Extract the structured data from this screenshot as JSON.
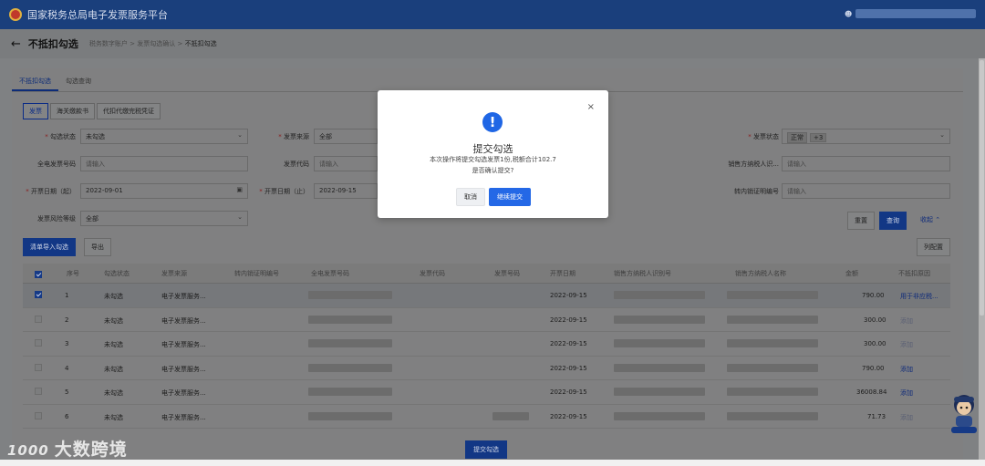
{
  "app": {
    "title": "国家税务总局电子发票服务平台",
    "user_icon": "user-icon"
  },
  "header": {
    "back_icon": "←",
    "title": "不抵扣勾选",
    "crumb1": "税务数字账户",
    "crumb2": "发票勾选确认",
    "crumb3": "不抵扣勾选",
    "sep": ">"
  },
  "tabs": [
    "不抵扣勾选",
    "勾选查询"
  ],
  "subtabs": [
    "发票",
    "海关缴款书",
    "代扣代缴完税凭证"
  ],
  "filters": {
    "check_status_label": "勾选状态",
    "check_status_value": "未勾选",
    "source_label": "发票来源",
    "source_value": "全部",
    "invoice_status_label": "发票状态",
    "invoice_status_tag": "正常",
    "invoice_status_more": "+3",
    "einvoice_no_label": "全电发票号码",
    "einvoice_no_placeholder": "请输入",
    "invoice_code_label": "发票代码",
    "invoice_code_placeholder": "请输入",
    "seller_id_label": "销售方纳税人识...",
    "seller_id_placeholder": "请输入",
    "date_start_label": "开票日期（起）",
    "date_start_value": "2022-09-01",
    "date_end_label": "开票日期（止）",
    "date_end_value": "2022-09-15",
    "transfer_no_label": "转内销证明编号",
    "transfer_no_placeholder": "请输入",
    "risk_label": "发票风险等级",
    "risk_value": "全部"
  },
  "buttons": {
    "reset": "重置",
    "query": "查询",
    "collapse": "收起",
    "import": "清单导入勾选",
    "export": "导出",
    "columns": "列配置",
    "submit": "提交勾选"
  },
  "table": {
    "headers": [
      "序号",
      "勾选状态",
      "发票来源",
      "转内销证明编号",
      "全电发票号码",
      "发票代码",
      "发票号码",
      "开票日期",
      "销售方纳税人识别号",
      "销售方纳税人名称",
      "金额",
      "不抵扣原因"
    ],
    "rows": [
      {
        "no": "1",
        "status": "未勾选",
        "source": "电子发票服务...",
        "date": "2022-09-15",
        "amount": "790.00",
        "reason": "用于非应税...",
        "checked": true
      },
      {
        "no": "2",
        "status": "未勾选",
        "source": "电子发票服务...",
        "date": "2022-09-15",
        "amount": "300.00",
        "reason": "添加",
        "checked": false
      },
      {
        "no": "3",
        "status": "未勾选",
        "source": "电子发票服务...",
        "date": "2022-09-15",
        "amount": "300.00",
        "reason": "添加",
        "checked": false
      },
      {
        "no": "4",
        "status": "未勾选",
        "source": "电子发票服务...",
        "date": "2022-09-15",
        "amount": "790.00",
        "reason": "添加",
        "checked": false
      },
      {
        "no": "5",
        "status": "未勾选",
        "source": "电子发票服务...",
        "date": "2022-09-15",
        "amount": "36008.84",
        "reason": "添加",
        "checked": false
      },
      {
        "no": "6",
        "status": "未勾选",
        "source": "电子发票服务...",
        "date": "2022-09-15",
        "amount": "71.73",
        "reason": "添加",
        "checked": false
      }
    ]
  },
  "modal": {
    "title": "提交勾选",
    "line1": "本次操作将提交勾选发票1份,税额合计102.7",
    "line2": "是否确认提交?",
    "cancel": "取消",
    "confirm": "继续提交",
    "close_icon": "×",
    "alert_icon": "!"
  },
  "watermark": {
    "logo": "1000",
    "text": "大数跨境"
  },
  "colors": {
    "topbar": "#1a3f7c",
    "primary": "#2468e6",
    "overlay": "#808081"
  }
}
